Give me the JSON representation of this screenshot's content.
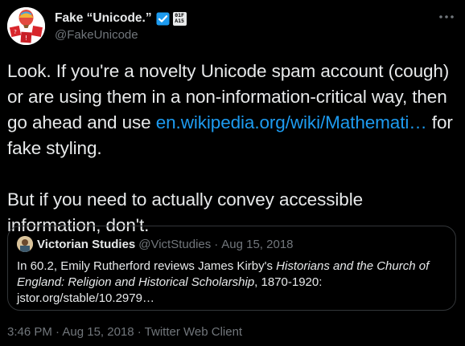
{
  "author": {
    "display_name": "Fake “Unicode.”",
    "handle": "@FakeUnicode",
    "badge_code_line1": "01F",
    "badge_code_line2": "A15"
  },
  "tweet": {
    "line1": "Look. If you're a novelty Unicode spam account (cough) or are using them in a non-information-critical way, then go ahead and use ",
    "link_text": "en.wikipedia.org/wiki/Mathemati…",
    "line1_end": " for fake styling.",
    "paragraph2": "But if you need to actually convey accessible information, don't."
  },
  "quote": {
    "name": "Victorian Studies",
    "handle": "@VictStudies",
    "separator": "·",
    "date": "Aug 15, 2018",
    "text_part1": "In 60.2, Emily Rutherford reviews James Kirby's ",
    "text_italic": "Historians and the Church of England: Religion and Historical Scholarship",
    "text_part2": ", 1870-1920: jstor.org/stable/10.2979…"
  },
  "footer": {
    "timestamp": "3:46 PM · Aug 15, 2018 · Twitter Web Client"
  },
  "colors": {
    "background": "#000000",
    "text": "#e7e9ea",
    "secondary": "#71767b",
    "link": "#1d9bf0",
    "border": "#333639"
  },
  "icons": {
    "verified": "verified-badge-icon",
    "more": "more-options-icon"
  }
}
